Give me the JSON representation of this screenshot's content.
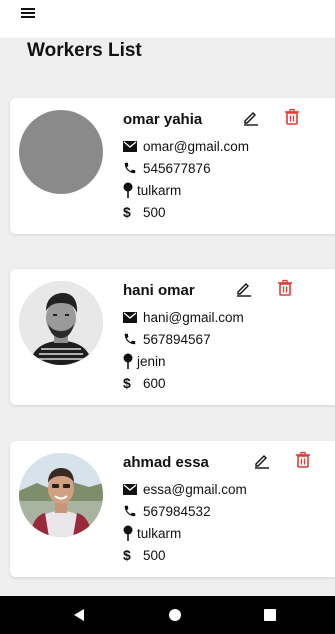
{
  "app": {
    "title": "Workers List"
  },
  "workers": [
    {
      "name": "omar yahia",
      "email": "omar@gmail.com",
      "phone": "545677876",
      "city": "tulkarm",
      "salary": "500",
      "avatar": "placeholder"
    },
    {
      "name": "hani omar",
      "email": "hani@gmail.com",
      "phone": "567894567",
      "city": "jenin",
      "salary": "600",
      "avatar": "man-bw-portrait"
    },
    {
      "name": "ahmad essa",
      "email": "essa@gmail.com",
      "phone": "567984532",
      "city": "tulkarm",
      "salary": "500",
      "avatar": "man-outdoor-photo"
    }
  ],
  "icons": {
    "menu": "menu-icon",
    "email": "email-icon",
    "phone": "phone-icon",
    "location": "location-pin-icon",
    "salary": "dollar-icon",
    "edit": "pencil-icon",
    "delete": "trash-icon",
    "nav_back": "triangle-back-icon",
    "nav_home": "circle-home-icon",
    "nav_recent": "square-recents-icon"
  },
  "colors": {
    "background": "#efefef",
    "card": "#ffffff",
    "delete": "#e53935",
    "navbar": "#000000",
    "text": "#111111"
  }
}
